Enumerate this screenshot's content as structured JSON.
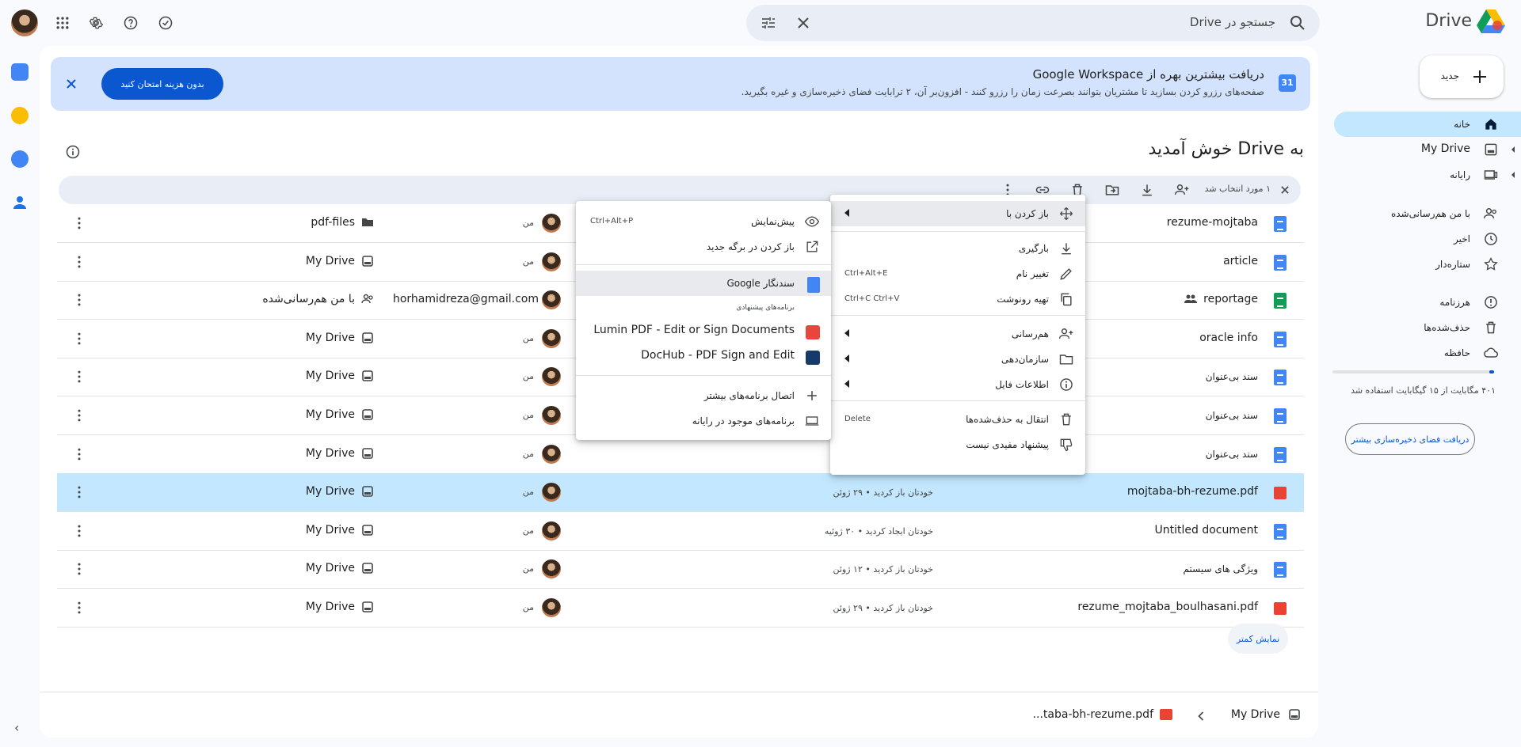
{
  "header": {
    "search_placeholder": "جستجو در Drive",
    "app_name": "Drive"
  },
  "banner": {
    "title": "دریافت بیشترین بهره از Google Workspace",
    "description": "صفحه‌های رزرو کردن بسازید تا مشتریان بتوانند بصرعت زمان را رزرو کنند - افزون‌بر آن، ۲ ترابایت فضای ذخیره‌سازی و غیره بگیرید.",
    "cal_day": "31",
    "button": "بدون هزینه امتحان کنید"
  },
  "welcome": "به Drive خوش آمدید",
  "action_bar": {
    "selected": "۱ مورد انتخاب شد"
  },
  "rows": [
    {
      "name": "rezume-mojtaba",
      "type": "doc",
      "owner": "من",
      "modified": "",
      "location": "pdf-files",
      "loc_icon": "folder"
    },
    {
      "name": "article",
      "type": "doc",
      "owner": "من",
      "modified": "",
      "location": "My Drive",
      "loc_icon": "drive"
    },
    {
      "name": "reportage",
      "type": "sheet",
      "shared": true,
      "owner_email": "horhamidreza@gmail.com",
      "modified": "",
      "location": "با من هم‌رسانی‌شده",
      "loc_icon": "shared"
    },
    {
      "name": "oracle info",
      "type": "doc",
      "owner": "من",
      "modified": "",
      "location": "My Drive",
      "loc_icon": "drive"
    },
    {
      "name": "سند بی‌عنوان",
      "type": "doc",
      "rtl": true,
      "owner": "من",
      "modified": "",
      "location": "My Drive",
      "loc_icon": "drive"
    },
    {
      "name": "سند بی‌عنوان",
      "type": "doc",
      "rtl": true,
      "owner": "من",
      "modified": "",
      "location": "My Drive",
      "loc_icon": "drive"
    },
    {
      "name": "سند بی‌عنوان",
      "type": "doc",
      "rtl": true,
      "owner": "من",
      "modified": "",
      "location": "My Drive",
      "loc_icon": "drive"
    },
    {
      "name": "mojtaba-bh-rezume.pdf",
      "type": "pdf",
      "selected": true,
      "owner": "من",
      "modified": "خودتان باز کردید • ۲۹ ژوئن",
      "location": "My Drive",
      "loc_icon": "drive"
    },
    {
      "name": "Untitled document",
      "type": "doc",
      "owner": "من",
      "modified": "خودتان ایجاد کردید • ۳۰ ژوئیه",
      "location": "My Drive",
      "loc_icon": "drive"
    },
    {
      "name": "ویژگی های سیستم",
      "type": "doc",
      "rtl": true,
      "owner": "من",
      "modified": "خودتان باز کردید • ۱۲ ژوئن",
      "location": "My Drive",
      "loc_icon": "drive"
    },
    {
      "name": "rezume_mojtaba_boulhasani.pdf",
      "type": "pdf",
      "owner": "من",
      "modified": "خودتان باز کردید • ۲۹ ژوئن",
      "location": "My Drive",
      "loc_icon": "drive"
    }
  ],
  "context_menu": {
    "items": [
      {
        "label": "باز کردن با",
        "icon": "open-with-icon",
        "submenu": true,
        "highlight": true
      },
      {
        "label": "بارگیری",
        "icon": "download-icon"
      },
      {
        "label": "تغییر نام",
        "icon": "rename-icon",
        "shortcut": "Ctrl+Alt+E"
      },
      {
        "label": "تهیه رونوشت",
        "icon": "copy-icon",
        "shortcut": "Ctrl+C Ctrl+V"
      },
      {
        "label": "هم‌رسانی",
        "icon": "share-icon",
        "submenu": true
      },
      {
        "label": "سازمان‌دهی",
        "icon": "organize-icon",
        "submenu": true
      },
      {
        "label": "اطلاعات فایل",
        "icon": "info-icon",
        "submenu": true
      },
      {
        "label": "انتقال به حذف‌شده‌ها",
        "icon": "trash-icon",
        "shortcut": "Delete"
      },
      {
        "label": "پیشنهاد مفیدی نیست",
        "icon": "thumbs-down-icon"
      }
    ]
  },
  "open_with_menu": {
    "preview": {
      "label": "پیش‌نمایش",
      "shortcut": "Ctrl+Alt+P"
    },
    "new_tab": {
      "label": "باز کردن در برگه جدید"
    },
    "google_docs": {
      "label": "سندنگار Google"
    },
    "suggested_header": "برنامه‌های پیشنهادی",
    "lumin": {
      "label": "Lumin PDF - Edit or Sign Documents"
    },
    "dochub": {
      "label": "DocHub - PDF Sign and Edit"
    },
    "connect_more": {
      "label": "اتصال برنامه‌های بیشتر"
    },
    "computer_apps": {
      "label": "برنامه‌های موجود در رایانه"
    }
  },
  "sidebar": {
    "new": "جدید",
    "home": "خانه",
    "my_drive": "My Drive",
    "computers": "رایانه",
    "shared": "با من هم‌رسانی‌شده",
    "recent": "اخیر",
    "starred": "ستاره‌دار",
    "spam": "هرزنامه",
    "trash": "حذف‌شده‌ها",
    "storage": "حافظه",
    "storage_text": "۴۰۱ مگابایت از ۱۵ گیگابایت استفاده شد",
    "storage_fraction": 0.03,
    "storage_button": "دریافت فضای ذخیره‌سازی بیشتر"
  },
  "show_less": "نمایش کمتر",
  "footer": {
    "root": "My Drive",
    "file": "...taba-bh-rezume.pdf"
  }
}
